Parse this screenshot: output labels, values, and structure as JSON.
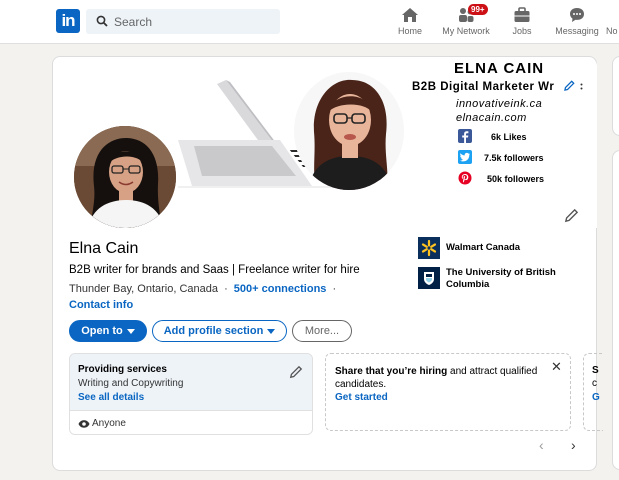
{
  "nav": {
    "logo": "in",
    "search_placeholder": "Search",
    "items": [
      {
        "label": "Home"
      },
      {
        "label": "My Network",
        "badge": "99+"
      },
      {
        "label": "Jobs"
      },
      {
        "label": "Messaging"
      },
      {
        "label": "No"
      }
    ]
  },
  "banner": {
    "name": "ELNA CAIN",
    "title": "B2B Digital Marketer Wr",
    "url1": "innovativeink.ca",
    "url2": "elnacain.com",
    "social": [
      {
        "icon": "facebook-icon",
        "text": "6k Likes",
        "color": "#3b5998"
      },
      {
        "icon": "twitter-icon",
        "text": "7.5k followers",
        "color": "#1da1f2"
      },
      {
        "icon": "pinterest-icon",
        "text": "50k followers",
        "color": "#e60023"
      }
    ]
  },
  "profile": {
    "name": "Elna Cain",
    "headline": "B2B writer for brands and Saas | Freelance writer for hire",
    "location": "Thunder Bay, Ontario, Canada",
    "separator": "·",
    "connections": "500+ connections",
    "contact": "Contact info"
  },
  "companies": [
    {
      "name": "Walmart Canada"
    },
    {
      "name": "The University of British Columbia"
    }
  ],
  "actions": {
    "open_to": "Open to",
    "add_section": "Add profile section",
    "more": "More..."
  },
  "services": {
    "title": "Providing services",
    "subtitle": "Writing and Copywriting",
    "link": "See all details",
    "visibility": "Anyone"
  },
  "hiring": {
    "bold": "Share that you’re hiring",
    "rest": " and attract qualified candidates.",
    "link": "Get started",
    "close": "✕"
  },
  "peek": {
    "l1": "S",
    "l2": "c",
    "l3": "G"
  },
  "carousel": {
    "prev": "‹",
    "next": "›"
  },
  "colors": {
    "accent": "#0a66c2",
    "badge": "#cc1016"
  }
}
